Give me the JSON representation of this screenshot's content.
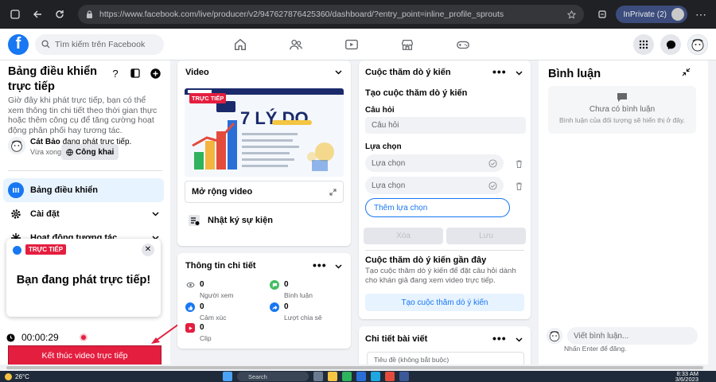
{
  "browser": {
    "url": "https://www.facebook.com/live/producer/v2/947627876425360/dashboard/?entry_point=inline_profile_sprouts",
    "inprivate_label": "InPrivate (2)"
  },
  "topnav": {
    "logo": "f",
    "search_placeholder": "Tìm kiếm trên Facebook"
  },
  "sidebar": {
    "title": "Bảng điều khiển trực tiếp",
    "help_glyph": "?",
    "description": "Giờ đây khi phát trực tiếp, bạn có thể xem thông tin chi tiết theo thời gian thực hoặc thêm công cụ để tăng cường hoạt động phân phối hay tương tác.",
    "user_name": "Cát Bảo",
    "user_status": "đang phát trực tiếp.",
    "user_time": "Vừa xong ·",
    "visibility": "Công khai",
    "nav": [
      {
        "label": "Bảng điều khiển",
        "active": true
      },
      {
        "label": "Cài đặt"
      },
      {
        "label": "Hoạt động tương tác"
      }
    ]
  },
  "toast": {
    "badge": "TRỰC TIẾP",
    "close_glyph": "✕",
    "message": "Bạn đang phát trực tiếp!"
  },
  "live": {
    "timer": "00:00:29",
    "end_button": "Kết thúc video trực tiếp"
  },
  "video_card": {
    "title": "Video",
    "live_badge": "TRỰC TIẾP",
    "thumb_headline": "7 LÝ DO",
    "expand_label": "Mở rộng video",
    "event_log_label": "Nhật ký sự kiện"
  },
  "details_card": {
    "title": "Thông tin chi tiết",
    "stats": [
      {
        "value": "0",
        "label": "Người xem"
      },
      {
        "value": "0",
        "label": "Bình luận"
      },
      {
        "value": "0",
        "label": "Cảm xúc"
      },
      {
        "value": "0",
        "label": "Lượt chia sẻ"
      },
      {
        "value": "0",
        "label": "Clip"
      }
    ],
    "more_label": "..."
  },
  "poll_card": {
    "title": "Cuộc thăm dò ý kiến",
    "create_heading": "Tạo cuộc thăm dò ý kiến",
    "question_label": "Câu hỏi",
    "question_placeholder": "Câu hỏi",
    "options_label": "Lựa chọn",
    "option_placeholder_1": "Lựa chọn",
    "option_placeholder_2": "Lựa chọn",
    "add_option": "Thêm lựa chọn",
    "delete_button": "Xóa",
    "save_button": "Lưu",
    "recent_title": "Cuộc thăm dò ý kiến gần đây",
    "recent_desc": "Tạo cuộc thăm dò ý kiến để đặt câu hỏi dành cho khán giả đang xem video trực tiếp.",
    "create_button": "Tạo cuộc thăm dò ý kiến"
  },
  "post_card": {
    "title": "Chi tiết bài viết",
    "title_placeholder": "Tiêu đề (không bắt buộc)"
  },
  "comments": {
    "title": "Bình luận",
    "empty_title": "Chưa có bình luận",
    "empty_desc": "Bình luận của đối tượng sẽ hiển thị ở đây.",
    "input_placeholder": "Viết bình luận...",
    "hint": "Nhấn Enter để đăng."
  },
  "taskbar": {
    "temp": "26°C",
    "search_placeholder": "Search",
    "time": "8:33 AM",
    "date": "3/6/2023"
  },
  "colors": {
    "fb_blue": "#1877f2",
    "live_red": "#e41e3f",
    "page_bg": "#f0f2f5"
  },
  "icons": {
    "browser": [
      "back-icon",
      "forward-icon",
      "refresh-icon",
      "lock-icon",
      "star-icon"
    ],
    "topnav_center": [
      "home-icon",
      "friends-icon",
      "watch-icon",
      "marketplace-icon",
      "gaming-icon"
    ],
    "topnav_right": [
      "menu-grid-icon",
      "messenger-icon",
      "avatar"
    ]
  }
}
